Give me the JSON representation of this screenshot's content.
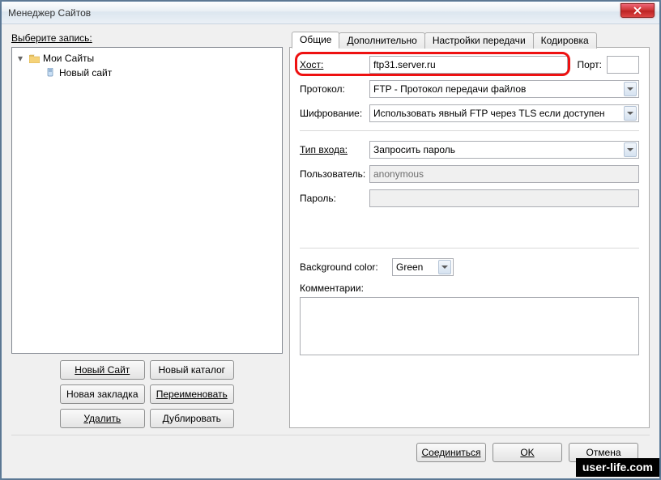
{
  "window": {
    "title": "Менеджер Сайтов"
  },
  "left": {
    "label": "Выберите запись:",
    "root": "Мои Сайты",
    "child": "Новый сайт",
    "buttons": {
      "new_site": "Новый Сайт",
      "new_folder": "Новый каталог",
      "new_bookmark": "Новая закладка",
      "rename": "Переименовать",
      "delete": "Удалить",
      "duplicate": "Дублировать"
    }
  },
  "tabs": {
    "general": "Общие",
    "advanced": "Дополнительно",
    "transfer": "Настройки передачи",
    "charset": "Кодировка"
  },
  "fields": {
    "host_label": "Хост:",
    "host_value": "ftp31.server.ru",
    "port_label": "Порт:",
    "port_value": "",
    "protocol_label": "Протокол:",
    "protocol_value": "FTP - Протокол передачи файлов",
    "encryption_label": "Шифрование:",
    "encryption_value": "Использовать явный FTP через TLS если доступен",
    "logontype_label": "Тип входа:",
    "logontype_value": "Запросить пароль",
    "user_label": "Пользователь:",
    "user_value": "anonymous",
    "pass_label": "Пароль:",
    "pass_value": "",
    "bgcolor_label": "Background color:",
    "bgcolor_value": "Green",
    "comments_label": "Комментарии:"
  },
  "footer": {
    "connect": "Соединиться",
    "ok": "OK",
    "cancel": "Отмена"
  },
  "watermark": "user-life.com"
}
